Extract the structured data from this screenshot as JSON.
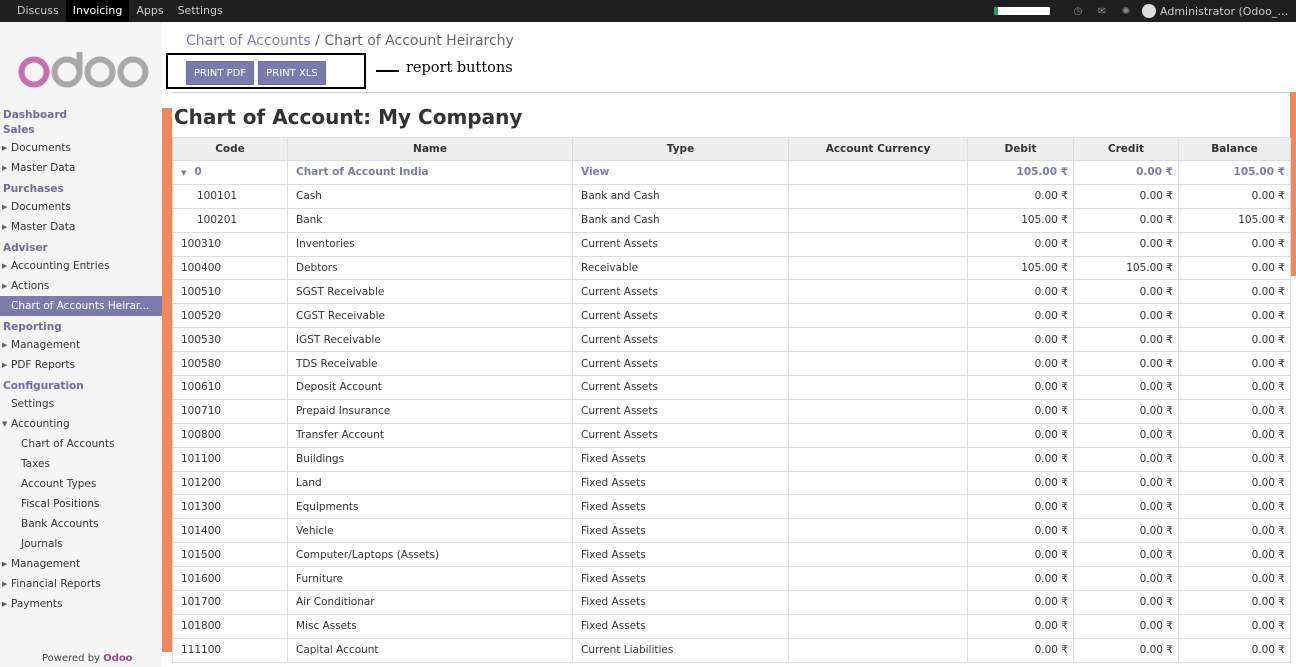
{
  "topbar": {
    "menus": [
      "Discuss",
      "Invoicing",
      "Apps",
      "Settings"
    ],
    "active_menu": "Invoicing",
    "icons": [
      "clock-icon",
      "chat-icon",
      "bug-icon"
    ],
    "user": "Administrator (Odoo_1..."
  },
  "logo_text": "odoo",
  "sidebar": {
    "dashboard": "Dashboard",
    "sales": "Sales",
    "sales_items": [
      "Documents",
      "Master Data"
    ],
    "purchases": "Purchases",
    "purchases_items": [
      "Documents",
      "Master Data"
    ],
    "adviser": "Adviser",
    "adviser_items": [
      "Accounting Entries",
      "Actions",
      "Chart of Accounts Heirar..."
    ],
    "reporting": "Reporting",
    "reporting_items": [
      "Management",
      "PDF Reports"
    ],
    "configuration": "Configuration",
    "settings": "Settings",
    "accounting": "Accounting",
    "accounting_items": [
      "Chart of Accounts",
      "Taxes",
      "Account Types",
      "Fiscal Positions",
      "Bank Accounts",
      "Journals"
    ],
    "tail_items": [
      "Management",
      "Financial Reports",
      "Payments"
    ],
    "powered_by": "Powered by",
    "powered_brand": "Odoo"
  },
  "breadcrumb": {
    "parent": "Chart of Accounts",
    "separator": "/",
    "current": "Chart of Account Heirarchy"
  },
  "buttons": {
    "print_pdf": "PRINT PDF",
    "print_xls": "PRINT XLS"
  },
  "annotation": "report buttons",
  "report": {
    "title": "Chart of Account: My Company",
    "columns": [
      "Code",
      "Name",
      "Type",
      "Account Currency",
      "Debit",
      "Credit",
      "Balance"
    ],
    "rows": [
      {
        "code": "0",
        "name": "Chart of Account India",
        "type": "View",
        "currency": "",
        "debit": "105.00 ₹",
        "credit": "0.00 ₹",
        "balance": "105.00 ₹",
        "level": 0,
        "root": true
      },
      {
        "code": "100101",
        "name": "Cash",
        "type": "Bank and Cash",
        "currency": "",
        "debit": "0.00 ₹",
        "credit": "0.00 ₹",
        "balance": "0.00 ₹",
        "level": 1
      },
      {
        "code": "100201",
        "name": "Bank",
        "type": "Bank and Cash",
        "currency": "",
        "debit": "105.00 ₹",
        "credit": "0.00 ₹",
        "balance": "105.00 ₹",
        "level": 1
      },
      {
        "code": "100310",
        "name": "Inventories",
        "type": "Current Assets",
        "currency": "",
        "debit": "0.00 ₹",
        "credit": "0.00 ₹",
        "balance": "0.00 ₹",
        "level": 0
      },
      {
        "code": "100400",
        "name": "Debtors",
        "type": "Receivable",
        "currency": "",
        "debit": "105.00 ₹",
        "credit": "105.00 ₹",
        "balance": "0.00 ₹",
        "level": 0
      },
      {
        "code": "100510",
        "name": "SGST Receivable",
        "type": "Current Assets",
        "currency": "",
        "debit": "0.00 ₹",
        "credit": "0.00 ₹",
        "balance": "0.00 ₹",
        "level": 0
      },
      {
        "code": "100520",
        "name": "CGST Receivable",
        "type": "Current Assets",
        "currency": "",
        "debit": "0.00 ₹",
        "credit": "0.00 ₹",
        "balance": "0.00 ₹",
        "level": 0
      },
      {
        "code": "100530",
        "name": "IGST Receivable",
        "type": "Current Assets",
        "currency": "",
        "debit": "0.00 ₹",
        "credit": "0.00 ₹",
        "balance": "0.00 ₹",
        "level": 0
      },
      {
        "code": "100580",
        "name": "TDS Receivable",
        "type": "Current Assets",
        "currency": "",
        "debit": "0.00 ₹",
        "credit": "0.00 ₹",
        "balance": "0.00 ₹",
        "level": 0
      },
      {
        "code": "100610",
        "name": "Deposit Account",
        "type": "Current Assets",
        "currency": "",
        "debit": "0.00 ₹",
        "credit": "0.00 ₹",
        "balance": "0.00 ₹",
        "level": 0
      },
      {
        "code": "100710",
        "name": "Prepaid Insurance",
        "type": "Current Assets",
        "currency": "",
        "debit": "0.00 ₹",
        "credit": "0.00 ₹",
        "balance": "0.00 ₹",
        "level": 0
      },
      {
        "code": "100800",
        "name": "Transfer Account",
        "type": "Current Assets",
        "currency": "",
        "debit": "0.00 ₹",
        "credit": "0.00 ₹",
        "balance": "0.00 ₹",
        "level": 0
      },
      {
        "code": "101100",
        "name": "Buildings",
        "type": "Fixed Assets",
        "currency": "",
        "debit": "0.00 ₹",
        "credit": "0.00 ₹",
        "balance": "0.00 ₹",
        "level": 0
      },
      {
        "code": "101200",
        "name": "Land",
        "type": "Fixed Assets",
        "currency": "",
        "debit": "0.00 ₹",
        "credit": "0.00 ₹",
        "balance": "0.00 ₹",
        "level": 0
      },
      {
        "code": "101300",
        "name": "Equipments",
        "type": "Fixed Assets",
        "currency": "",
        "debit": "0.00 ₹",
        "credit": "0.00 ₹",
        "balance": "0.00 ₹",
        "level": 0
      },
      {
        "code": "101400",
        "name": "Vehicle",
        "type": "Fixed Assets",
        "currency": "",
        "debit": "0.00 ₹",
        "credit": "0.00 ₹",
        "balance": "0.00 ₹",
        "level": 0
      },
      {
        "code": "101500",
        "name": "Computer/Laptops (Assets)",
        "type": "Fixed Assets",
        "currency": "",
        "debit": "0.00 ₹",
        "credit": "0.00 ₹",
        "balance": "0.00 ₹",
        "level": 0
      },
      {
        "code": "101600",
        "name": "Furniture",
        "type": "Fixed Assets",
        "currency": "",
        "debit": "0.00 ₹",
        "credit": "0.00 ₹",
        "balance": "0.00 ₹",
        "level": 0
      },
      {
        "code": "101700",
        "name": "Air Conditionar",
        "type": "Fixed Assets",
        "currency": "",
        "debit": "0.00 ₹",
        "credit": "0.00 ₹",
        "balance": "0.00 ₹",
        "level": 0
      },
      {
        "code": "101800",
        "name": "Misc Assets",
        "type": "Fixed Assets",
        "currency": "",
        "debit": "0.00 ₹",
        "credit": "0.00 ₹",
        "balance": "0.00 ₹",
        "level": 0
      },
      {
        "code": "111100",
        "name": "Capital Account",
        "type": "Current Liabilities",
        "currency": "",
        "debit": "0.00 ₹",
        "credit": "0.00 ₹",
        "balance": "0.00 ₹",
        "level": 0
      }
    ]
  }
}
